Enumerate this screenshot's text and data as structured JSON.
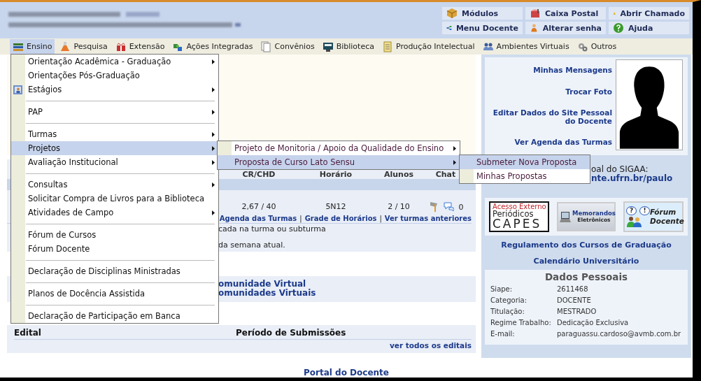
{
  "header_buttons": [
    {
      "label": "Módulos"
    },
    {
      "label": "Caixa Postal"
    },
    {
      "label": "Abrir Chamado"
    },
    {
      "label": "Menu Docente"
    },
    {
      "label": "Alterar senha"
    },
    {
      "label": "Ajuda"
    }
  ],
  "menubar": [
    {
      "label": "Ensino",
      "selected": true
    },
    {
      "label": "Pesquisa",
      "selected": false
    },
    {
      "label": "Extensão",
      "selected": false
    },
    {
      "label": "Ações Integradas",
      "selected": false
    },
    {
      "label": "Convênios",
      "selected": false
    },
    {
      "label": "Biblioteca",
      "selected": false
    },
    {
      "label": "Produção Intelectual",
      "selected": false
    },
    {
      "label": "Ambientes Virtuais",
      "selected": false
    },
    {
      "label": "Outros",
      "selected": false
    }
  ],
  "ensino_menu": {
    "items": [
      {
        "kind": "item",
        "label": "Orientação Acadêmica - Graduação",
        "submenu": true,
        "selected": false
      },
      {
        "kind": "item",
        "label": "Orientações Pós-Graduação",
        "submenu": false,
        "selected": false
      },
      {
        "kind": "icon_item",
        "label": "Estágios",
        "submenu": true,
        "selected": false
      },
      {
        "kind": "separator"
      },
      {
        "kind": "item",
        "label": "PAP",
        "submenu": true,
        "selected": false
      },
      {
        "kind": "separator"
      },
      {
        "kind": "item",
        "label": "Turmas",
        "submenu": true,
        "selected": false
      },
      {
        "kind": "item",
        "label": "Projetos",
        "submenu": true,
        "selected": true,
        "children": [
          {
            "kind": "item",
            "label": "Projeto de Monitoria / Apoio da Qualidade do Ensino",
            "submenu": true,
            "selected": false
          },
          {
            "kind": "item",
            "label": "Proposta de Curso Lato Sensu",
            "submenu": true,
            "selected": true,
            "children": [
              {
                "kind": "item",
                "label": "Submeter Nova Proposta",
                "submenu": false,
                "selected": true
              },
              {
                "kind": "item",
                "label": "Minhas Propostas",
                "submenu": false,
                "selected": false
              }
            ]
          }
        ]
      },
      {
        "kind": "item",
        "label": "Avaliação Institucional",
        "submenu": true,
        "selected": false
      },
      {
        "kind": "separator"
      },
      {
        "kind": "item",
        "label": "Consultas",
        "submenu": true,
        "selected": false
      },
      {
        "kind": "item",
        "label": "Solicitar Compra de Livros para a Biblioteca",
        "submenu": false,
        "selected": false
      },
      {
        "kind": "item",
        "label": "Atividades de Campo",
        "submenu": true,
        "selected": false
      },
      {
        "kind": "separator"
      },
      {
        "kind": "item",
        "label": "Fórum de Cursos",
        "submenu": false,
        "selected": false
      },
      {
        "kind": "item",
        "label": "Fórum Docente",
        "submenu": false,
        "selected": false
      },
      {
        "kind": "separator"
      },
      {
        "kind": "item",
        "label": "Declaração de Disciplinas Ministradas",
        "submenu": false,
        "selected": false
      },
      {
        "kind": "separator"
      },
      {
        "kind": "item",
        "label": "Planos de Docência Assistida",
        "submenu": false,
        "selected": false
      },
      {
        "kind": "separator"
      },
      {
        "kind": "item",
        "label": "Declaração de Participação em Banca",
        "submenu": false,
        "selected": false
      }
    ]
  },
  "turmas_table": {
    "columns": [
      "CR/CHD",
      "Horário",
      "Alunos",
      "Chat"
    ],
    "row": {
      "cells": [
        "2,67 / 40",
        "5N12",
        "2 / 10"
      ],
      "chat_count": "0"
    },
    "links": [
      "Agenda das Turmas",
      "Grade de Horários",
      "Ver turmas anteriores"
    ],
    "link_separator": "|",
    "notes": [
      "cada na turma ou subturma",
      "da semana atual."
    ]
  },
  "comunidades": [
    "omunidade Virtual",
    "omunidades Virtuais"
  ],
  "editais": {
    "columns": [
      "Edital",
      "Período de Submissões"
    ],
    "more_link": "ver todos os editais"
  },
  "footer_link": "Portal do Docente",
  "profile": {
    "links": [
      "Minhas Mensagens",
      "Trocar Foto",
      "Editar Dados do Site Pessoal do Docente",
      "Ver Agenda das Turmas"
    ]
  },
  "site_pessoal": {
    "label": "oal do SIGAA:",
    "url": "nte.ufrn.br/paulo"
  },
  "banners": [
    {
      "kind": "capes",
      "lines": [
        "Acesso Externo",
        "Periódicos",
        "CAPES"
      ]
    },
    {
      "kind": "memorandos",
      "lines": [
        "Memorandos",
        "Eletrônicos"
      ]
    },
    {
      "kind": "forum",
      "bubbles": [
        "?",
        "!"
      ],
      "lines": [
        "Fórum",
        "Docente"
      ]
    }
  ],
  "institutional_links": [
    "Regulamento dos Cursos de Graduação",
    "Calendário Universitário"
  ],
  "dados_pessoais": {
    "title": "Dados Pessoais",
    "fields": [
      {
        "label": "Siape:",
        "value": "2611468"
      },
      {
        "label": "Categoria:",
        "value": "DOCENTE"
      },
      {
        "label": "Titulação:",
        "value": "MESTRADO"
      },
      {
        "label": "Regime Trabalho:",
        "value": "Dedicação Exclusiva"
      },
      {
        "label": "E-mail:",
        "value": "paraguassu.cardoso@avmb.com.br"
      }
    ]
  }
}
